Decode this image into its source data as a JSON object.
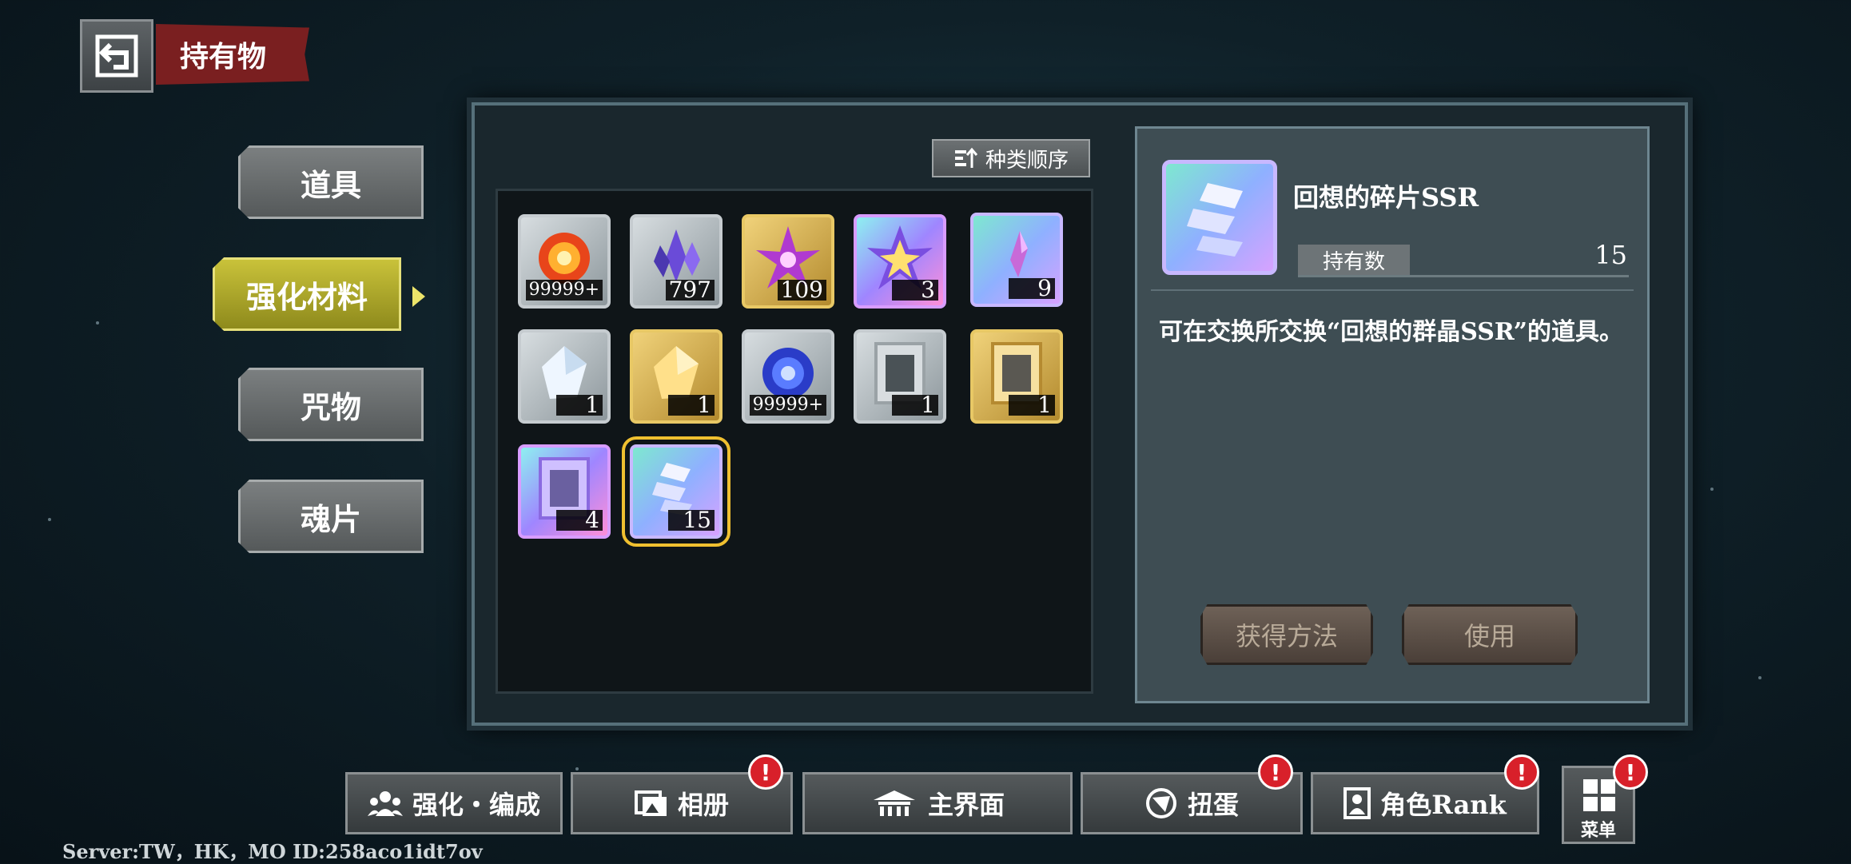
{
  "header": {
    "title": "持有物"
  },
  "sidebar": {
    "tabs": [
      {
        "label": "道具"
      },
      {
        "label": "强化材料"
      },
      {
        "label": "咒物"
      },
      {
        "label": "魂片"
      }
    ],
    "active_index": 1
  },
  "inventory": {
    "sort_label": "种类顺序",
    "items": [
      {
        "icon": "fire-orb-icon",
        "rarity": "silver",
        "count": "99999+"
      },
      {
        "icon": "purple-crystal-icon",
        "rarity": "silver",
        "count": "797"
      },
      {
        "icon": "purple-crystal-cluster-icon",
        "rarity": "gold",
        "count": "109"
      },
      {
        "icon": "rainbow-crystal-cluster-icon",
        "rarity": "rainbow",
        "count": "3"
      },
      {
        "icon": "pink-crystal-shard-icon",
        "rarity": "holo",
        "count": "9"
      },
      {
        "icon": "white-crystal-icon",
        "rarity": "silver",
        "count": "1"
      },
      {
        "icon": "gold-crystal-icon",
        "rarity": "gold",
        "count": "1"
      },
      {
        "icon": "blue-orb-icon",
        "rarity": "silver",
        "count": "99999+"
      },
      {
        "icon": "silver-frame-icon",
        "rarity": "silver",
        "count": "1"
      },
      {
        "icon": "gold-frame-icon",
        "rarity": "gold",
        "count": "1"
      },
      {
        "icon": "rainbow-frame-icon",
        "rarity": "rainbow",
        "count": "4"
      },
      {
        "icon": "memory-fragment-icon",
        "rarity": "holo",
        "count": "15",
        "selected": true
      }
    ]
  },
  "detail": {
    "name": "回想的碎片SSR",
    "owned_label": "持有数",
    "owned_value": "15",
    "description": "可在交换所交换“回想的群晶SSR”的道具。",
    "obtain_label": "获得方法",
    "use_label": "使用"
  },
  "bottom_nav": {
    "items": [
      {
        "label": "强化・编成",
        "icon": "team-icon",
        "alert": false
      },
      {
        "label": "相册",
        "icon": "album-icon",
        "alert": true
      },
      {
        "label": "主界面",
        "icon": "home-icon",
        "alert": false
      },
      {
        "label": "扭蛋",
        "icon": "gacha-icon",
        "alert": true
      },
      {
        "label": "角色Rank",
        "icon": "character-icon",
        "alert": true
      }
    ],
    "menu_label": "菜单",
    "alert_symbol": "!"
  },
  "footer": {
    "server_info": "Server:TW，HK，MO ID:258aco1idt7ov"
  }
}
